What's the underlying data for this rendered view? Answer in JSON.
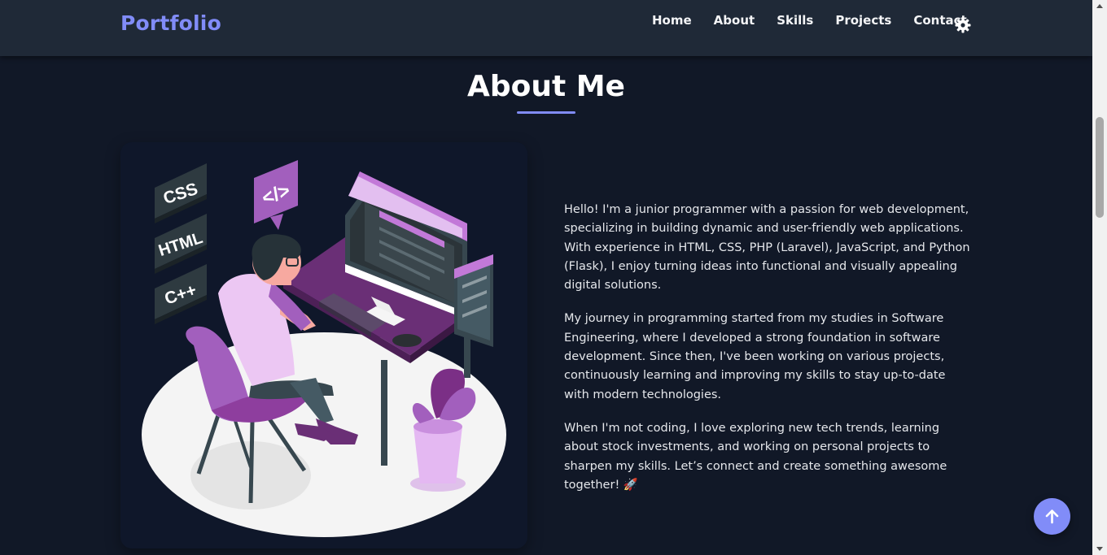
{
  "brand": "Portfolio",
  "nav": {
    "links": [
      "Home",
      "About",
      "Skills",
      "Projects",
      "Contact"
    ],
    "theme_icon": "gear-icon"
  },
  "about": {
    "title": "About Me",
    "paragraphs": [
      "Hello! I'm a junior programmer with a passion for web development, specializing in building dynamic and user-friendly web applications. With experience in HTML, CSS, PHP (Laravel), JavaScript, and Python (Flask), I enjoy turning ideas into functional and visually appealing digital solutions.",
      "My journey in programming started from my studies in Software Engineering, where I developed a strong foundation in software development. Since then, I've been working on various projects, continuously learning and improving my skills to stay up-to-date with modern technologies.",
      "When I'm not coding, I love exploring new tech trends, learning about stock investments, and working on personal projects to sharpen my skills. Let’s connect and create something awesome together! 🚀"
    ],
    "illustration": {
      "badges": [
        "CSS",
        "HTML",
        "C++"
      ],
      "code_bubble": "</>"
    }
  },
  "scroll_top_icon": "arrow-up-icon",
  "colors": {
    "accent": "#818cf8",
    "navbar_bg": "#1f2937",
    "page_bg": "#111827",
    "card_bg": "#0f172a",
    "illustration_purple": "#a25fbd"
  }
}
